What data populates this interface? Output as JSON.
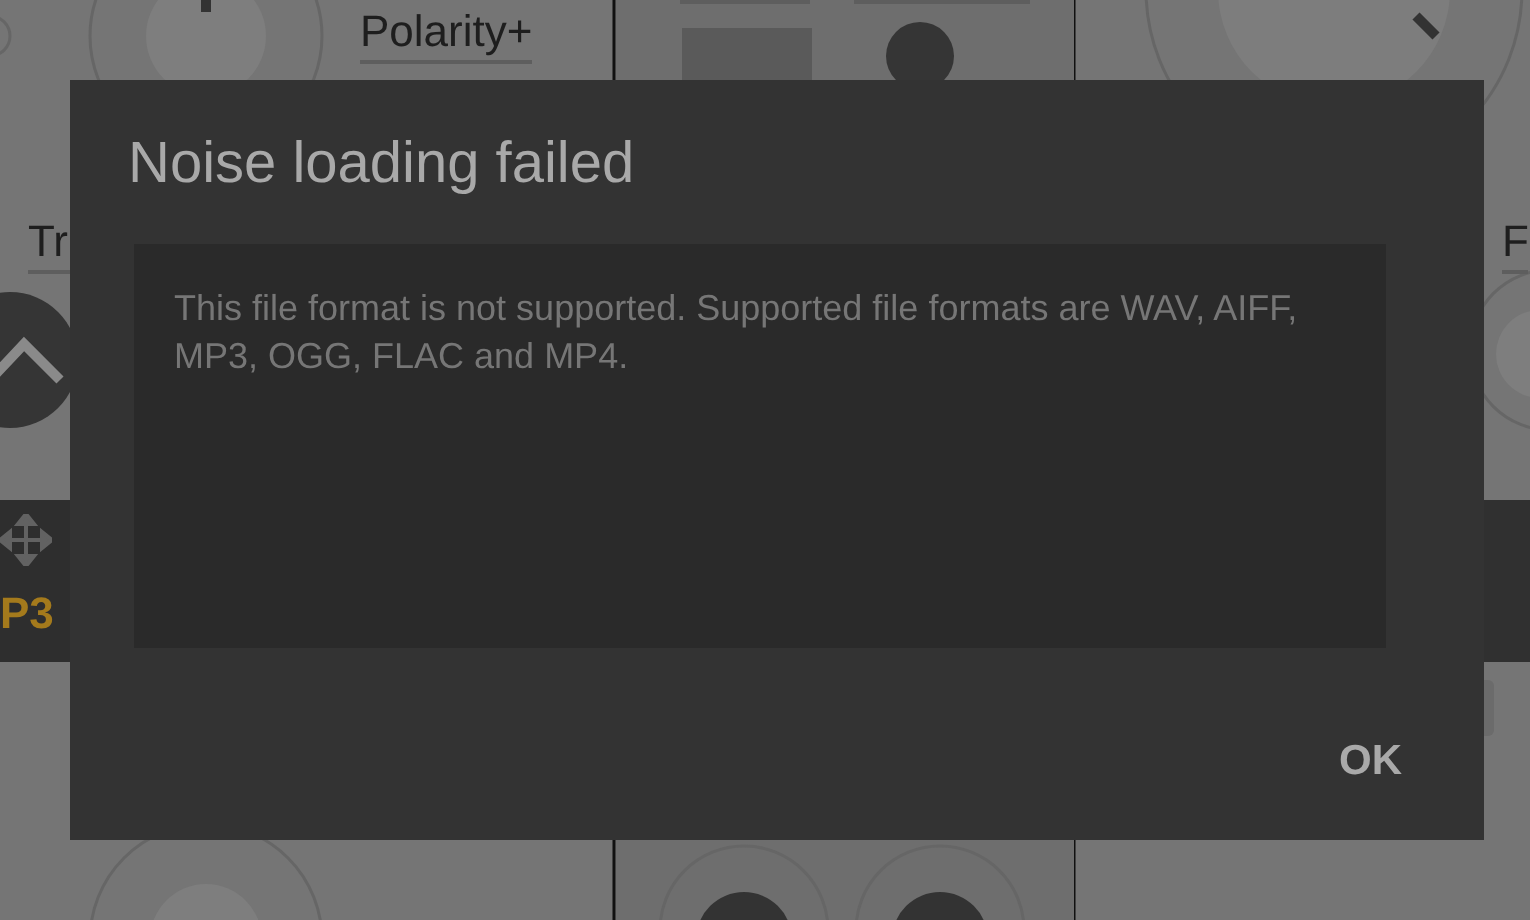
{
  "background": {
    "labels": [
      {
        "kind": "polarity",
        "text": "Polarity+"
      },
      {
        "kind": "tr",
        "text": "Tr"
      },
      {
        "kind": "f",
        "text": "F"
      }
    ],
    "slot_text": "P3"
  },
  "dialog": {
    "title": "Noise loading failed",
    "message": "This file format is not supported. Supported file formats are WAV, AIFF, MP3, OGG, FLAC and MP4.",
    "buttons": [
      "OK"
    ]
  }
}
